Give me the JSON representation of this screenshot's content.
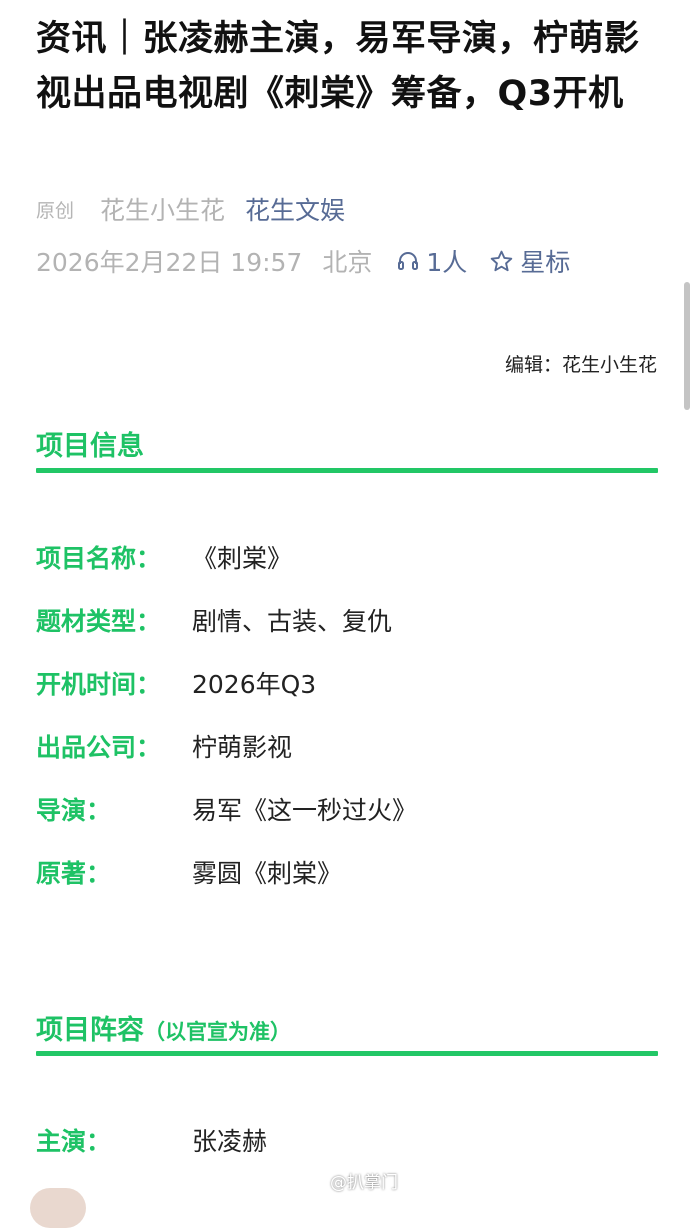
{
  "article": {
    "title": "资讯｜张凌赫主演，易军导演，柠萌影视出品电视剧《刺棠》筹备，Q3开机",
    "original_tag": "原创",
    "author": "花生小生花",
    "account": "花生文娱",
    "date": "2026年2月22日 19:57",
    "location": "北京",
    "listen_count": "1人",
    "star_label": "星标",
    "editor": "编辑：花生小生花"
  },
  "sections": {
    "project_info": {
      "heading": "项目信息",
      "rows": [
        {
          "label": "项目名称：",
          "value": "《刺棠》"
        },
        {
          "label": "题材类型：",
          "value": "剧情、古装、复仇"
        },
        {
          "label": "开机时间：",
          "value": "2026年Q3"
        },
        {
          "label": "出品公司：",
          "value": "柠萌影视"
        },
        {
          "label": "导演：",
          "value": "易军《这一秒过火》"
        },
        {
          "label": "原著：",
          "value": "雾圆《刺棠》"
        }
      ]
    },
    "cast": {
      "heading": "项目阵容",
      "heading_note": "（以官宣为准）",
      "rows": [
        {
          "label": "主演：",
          "value": "张凌赫"
        }
      ]
    }
  },
  "watermark": "@扒掌门",
  "colors": {
    "accent_green": "#1ec265",
    "link_blue": "#576b95",
    "meta_gray": "#b3b3b3"
  },
  "icons": {
    "listen": "headphones-icon",
    "star": "star-outline-icon",
    "weibo": "weibo-icon"
  }
}
